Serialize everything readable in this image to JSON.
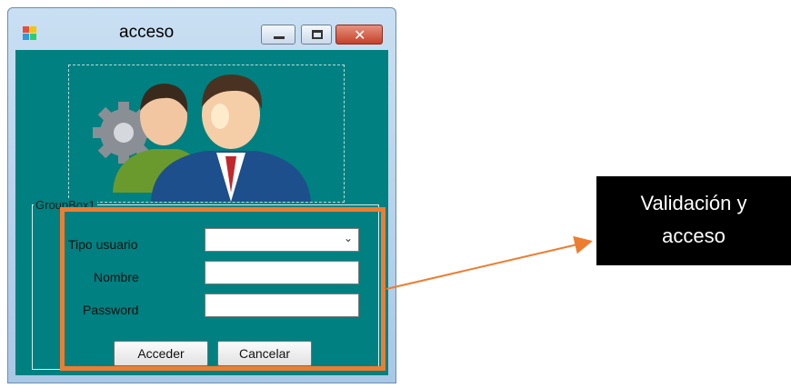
{
  "window": {
    "title": "acceso",
    "icons": {
      "app": "app-icon",
      "minimize": "minimize-icon",
      "maximize": "maximize-icon",
      "close": "close-icon"
    },
    "close_glyph": "✕"
  },
  "form": {
    "groupbox_label": "GroupBox1",
    "tipo_usuario_label": "Tipo usuario",
    "tipo_usuario_value": "",
    "nombre_label": "Nombre",
    "nombre_value": "",
    "password_label": "Password",
    "password_value": "",
    "accept_button": "Acceder",
    "cancel_button": "Cancelar"
  },
  "annotation": {
    "line1": "Validación y",
    "line2": "acceso",
    "color": "#ed7d31"
  },
  "colors": {
    "form_background": "#008080",
    "highlight": "#ed7d31",
    "callout_background": "#000000"
  }
}
